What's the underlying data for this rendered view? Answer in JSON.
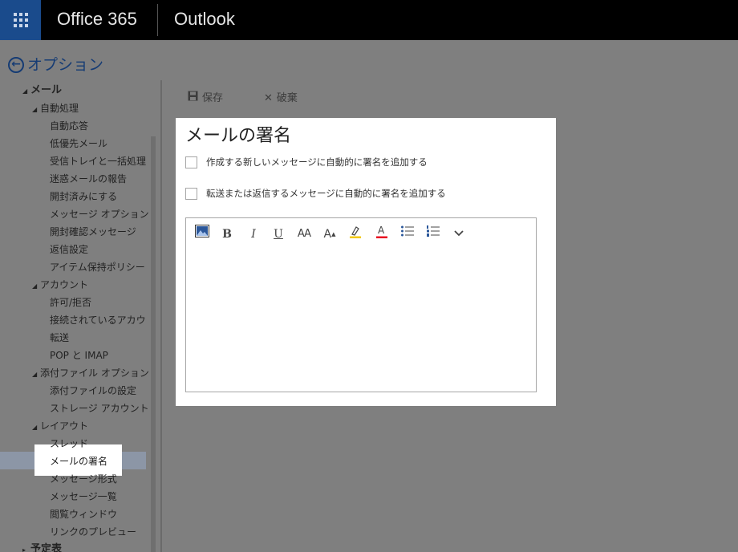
{
  "header": {
    "brand": "Office 365",
    "app": "Outlook"
  },
  "options": {
    "title": "オプション"
  },
  "nav": {
    "items": [
      {
        "label": "メール",
        "level": 1
      },
      {
        "label": "自動処理",
        "level": 2
      },
      {
        "label": "自動応答",
        "level": 3
      },
      {
        "label": "低優先メール",
        "level": 3
      },
      {
        "label": "受信トレイと一括処理",
        "level": 3
      },
      {
        "label": "迷惑メールの報告",
        "level": 3
      },
      {
        "label": "開封済みにする",
        "level": 3
      },
      {
        "label": "メッセージ オプション",
        "level": 3
      },
      {
        "label": "開封確認メッセージ",
        "level": 3
      },
      {
        "label": "返信設定",
        "level": 3
      },
      {
        "label": "アイテム保持ポリシー",
        "level": 3
      },
      {
        "label": "アカウント",
        "level": 2
      },
      {
        "label": "許可/拒否",
        "level": 3
      },
      {
        "label": "接続されているアカウ",
        "level": 3
      },
      {
        "label": "転送",
        "level": 3
      },
      {
        "label": "POP と IMAP",
        "level": 3
      },
      {
        "label": "添付ファイル オプション",
        "level": 2
      },
      {
        "label": "添付ファイルの設定",
        "level": 3
      },
      {
        "label": "ストレージ アカウント",
        "level": 3
      },
      {
        "label": "レイアウト",
        "level": 2
      },
      {
        "label": "スレッド",
        "level": 3
      },
      {
        "label": "メールの署名",
        "level": 3
      },
      {
        "label": "メッセージ形式",
        "level": 3
      },
      {
        "label": "メッセージ一覧",
        "level": 3
      },
      {
        "label": "閲覧ウィンドウ",
        "level": 3
      },
      {
        "label": "リンクのプレビュー",
        "level": 3
      },
      {
        "label": "予定表",
        "level": 1
      }
    ]
  },
  "toolbar": {
    "save_label": "保存",
    "discard_label": "破棄"
  },
  "dialog": {
    "title": "メールの署名",
    "checkbox_new": "作成する新しいメッセージに自動的に署名を追加する",
    "checkbox_reply": "転送または返信するメッセージに自動的に署名を追加する"
  },
  "format_toolbar": {
    "bold": "B",
    "italic": "I",
    "underline": "U",
    "font_size": "AA",
    "grow": "A",
    "font_color": "A"
  },
  "colors": {
    "topbar": "#000000",
    "waffle_bg": "#1a4b8c",
    "accent": "#163c74",
    "overlay": "#7f7f7f",
    "highlight_yellow": "#f2c811",
    "font_red": "#e81123"
  }
}
